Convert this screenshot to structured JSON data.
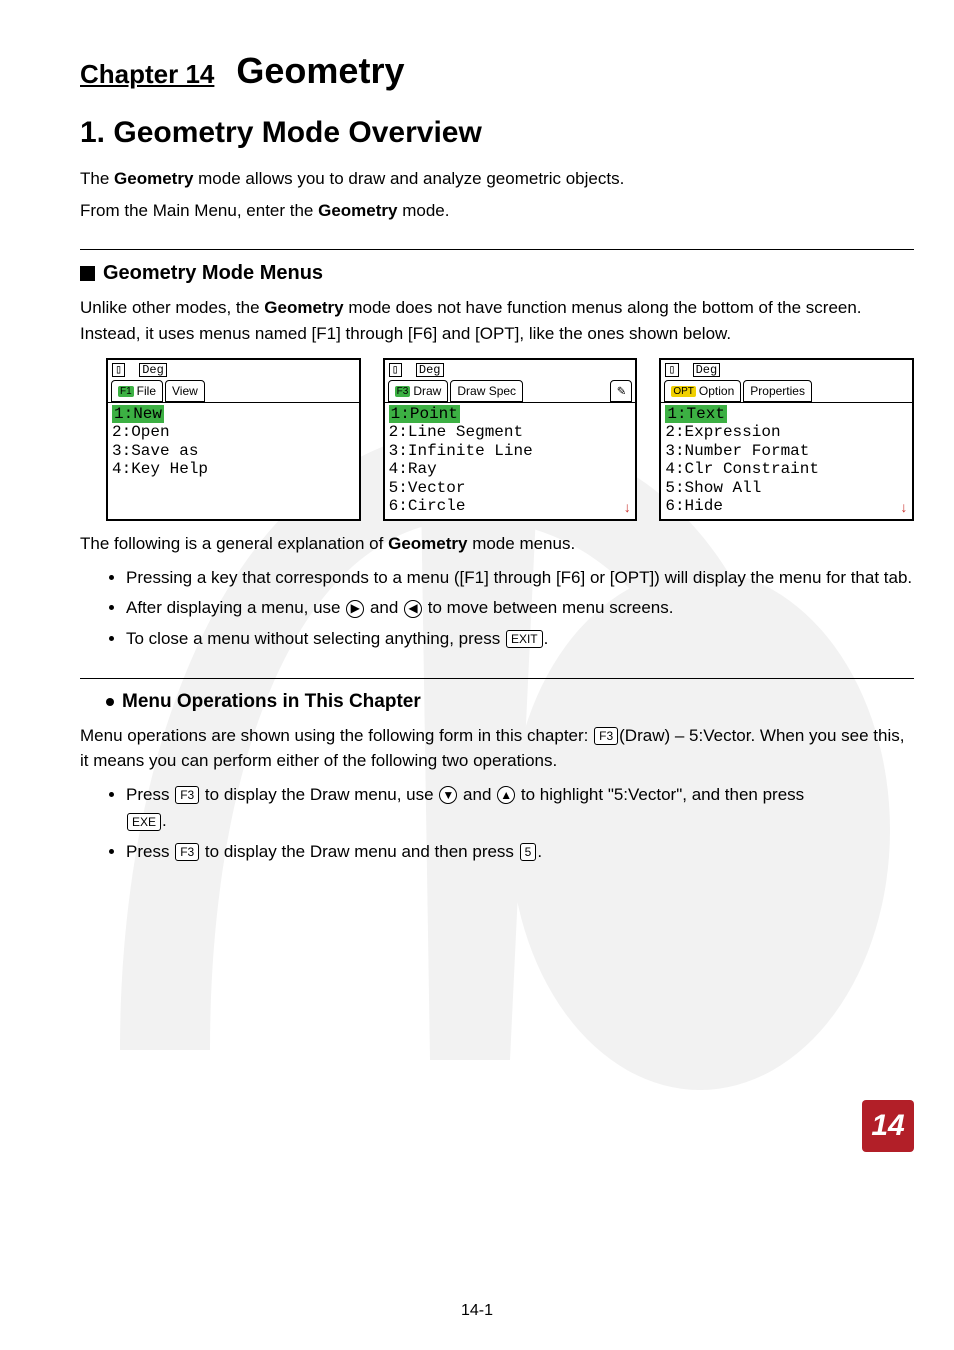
{
  "chapter": {
    "label": "Chapter 14",
    "title": "Geometry"
  },
  "section1": {
    "title": "1. Geometry Mode Overview"
  },
  "intro": {
    "p1a": "The ",
    "p1b": "Geometry",
    "p1c": " mode allows you to draw and analyze geometric objects.",
    "p2a": "From the Main Menu, enter the ",
    "p2b": "Geometry",
    "p2c": " mode."
  },
  "menus": {
    "heading": "Geometry Mode Menus",
    "p1a": "Unlike other modes, the ",
    "p1b": "Geometry",
    "p1c": " mode does not have function menus along the bottom of the screen. Instead, it uses menus named [F1] through [F6] and [OPT], like the ones shown below."
  },
  "screens": [
    {
      "badge": "F1",
      "badgeClass": "green",
      "tabs": [
        "File",
        "View"
      ],
      "items": [
        "1:New",
        "2:Open",
        "3:Save as",
        "4:Key Help"
      ],
      "highlight": 0,
      "pencil": false,
      "arrow": false
    },
    {
      "badge": "F3",
      "badgeClass": "green",
      "tabs": [
        "Draw",
        "Draw Spec"
      ],
      "items": [
        "1:Point",
        "2:Line Segment",
        "3:Infinite Line",
        "4:Ray",
        "5:Vector",
        "6:Circle"
      ],
      "highlight": 0,
      "pencil": true,
      "arrow": true
    },
    {
      "badge": "OPT",
      "badgeClass": "yellow",
      "tabs": [
        "Option",
        "Properties"
      ],
      "items": [
        "1:Text",
        "2:Expression",
        "3:Number Format",
        "4:Clr Constraint",
        "5:Show All",
        "6:Hide"
      ],
      "highlight": 0,
      "pencil": false,
      "arrow": true
    }
  ],
  "after_screens": {
    "p1a": "The following is a general explanation of ",
    "p1b": "Geometry",
    "p1c": " mode menus."
  },
  "bullets1": {
    "b1": "Pressing a key that corresponds to a menu ([F1] through [F6] or [OPT]) will display the menu for that tab.",
    "b2a": "After displaying a menu, use ",
    "b2b": " and ",
    "b2c": " to move between menu screens.",
    "b3a": "To close a menu without selecting anything, press ",
    "b3b": "."
  },
  "ops": {
    "heading": "Menu Operations in This Chapter",
    "p1a": "Menu operations are shown using the following form in this chapter: ",
    "p1b": "(Draw) – 5:Vector. When you see this, it means you can perform either of the following two operations."
  },
  "bullets2": {
    "b1a": "Press ",
    "b1b": " to display the Draw menu, use ",
    "b1c": " and ",
    "b1d": " to highlight \"5:Vector\", and then press ",
    "b1e": ".",
    "b2a": "Press ",
    "b2b": " to display the Draw menu and then press ",
    "b2c": "."
  },
  "keys": {
    "F3": "F3",
    "EXIT": "EXIT",
    "EXE": "EXE",
    "five": "5",
    "right": "▶",
    "left": "◀",
    "down": "▼",
    "up": "▲"
  },
  "footer": {
    "page": "14-1",
    "badge": "14"
  }
}
